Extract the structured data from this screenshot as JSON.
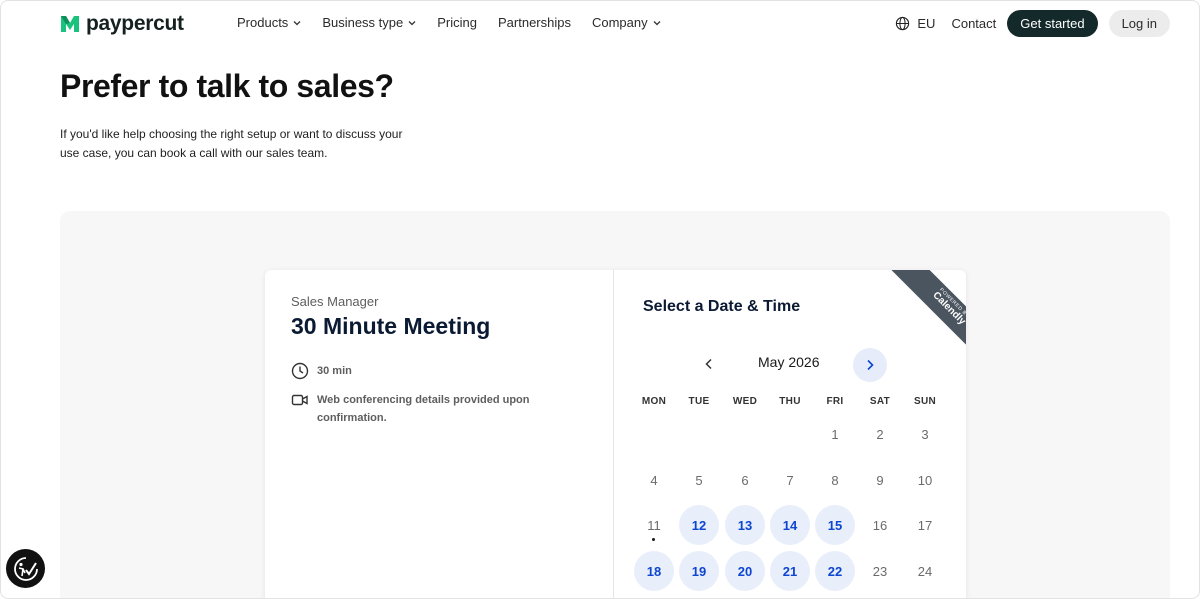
{
  "nav": {
    "logo_text": "paypercut",
    "menu": [
      {
        "label": "Products",
        "has_dropdown": true
      },
      {
        "label": "Business type",
        "has_dropdown": true
      },
      {
        "label": "Pricing",
        "has_dropdown": false
      },
      {
        "label": "Partnerships",
        "has_dropdown": false
      },
      {
        "label": "Company",
        "has_dropdown": true
      }
    ],
    "locale": "EU",
    "contact": "Contact",
    "get_started": "Get started",
    "login": "Log in"
  },
  "hero": {
    "title": "Prefer to talk to sales?",
    "text": "If you'd like help choosing the right setup or want to discuss your use case, you can book a call with our sales team."
  },
  "scheduler": {
    "host": "Sales Manager",
    "meeting_title": "30 Minute Meeting",
    "duration": "30 min",
    "location": "Web conferencing details provided upon confirmation.",
    "select_title": "Select a Date & Time",
    "ribbon_small": "POWERED BY",
    "ribbon_big": "Calendly",
    "month": "May 2026",
    "weekdays": [
      "MON",
      "TUE",
      "WED",
      "THU",
      "FRI",
      "SAT",
      "SUN"
    ],
    "weeks": [
      [
        null,
        null,
        null,
        null,
        {
          "d": "1"
        },
        {
          "d": "2"
        },
        {
          "d": "3"
        }
      ],
      [
        {
          "d": "4"
        },
        {
          "d": "5"
        },
        {
          "d": "6"
        },
        {
          "d": "7"
        },
        {
          "d": "8"
        },
        {
          "d": "9"
        },
        {
          "d": "10"
        }
      ],
      [
        {
          "d": "11",
          "today": true
        },
        {
          "d": "12",
          "available": true
        },
        {
          "d": "13",
          "available": true
        },
        {
          "d": "14",
          "available": true
        },
        {
          "d": "15",
          "available": true
        },
        {
          "d": "16"
        },
        {
          "d": "17"
        }
      ],
      [
        {
          "d": "18",
          "available": true
        },
        {
          "d": "19",
          "available": true
        },
        {
          "d": "20",
          "available": true
        },
        {
          "d": "21",
          "available": true
        },
        {
          "d": "22",
          "available": true
        },
        {
          "d": "23"
        },
        {
          "d": "24"
        }
      ]
    ]
  },
  "colors": {
    "brand_dark": "#14292a",
    "logo_green": "#19c37d",
    "available_bg": "#e9eefb",
    "available_text": "#0d46d1"
  },
  "icons": {
    "logo": "paypercut-logo-icon",
    "locale": "globe-icon",
    "duration": "clock-icon",
    "location": "video-camera-icon",
    "prev": "chevron-left-icon",
    "next": "chevron-right-icon",
    "accessibility": "accessibility-icon"
  }
}
